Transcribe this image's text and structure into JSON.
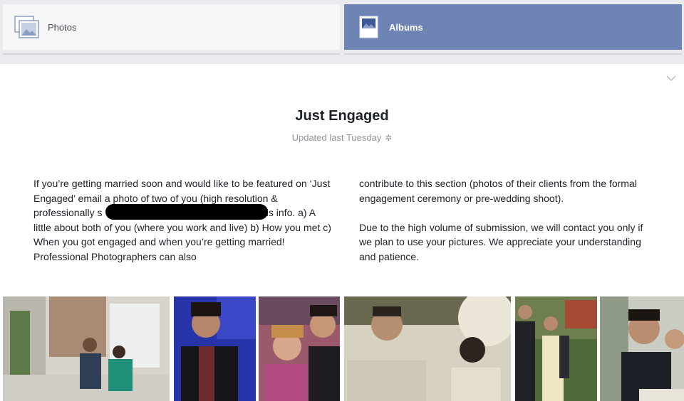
{
  "tabs": [
    {
      "label": "Photos",
      "icon": "photos-icon",
      "active": false
    },
    {
      "label": "Albums",
      "icon": "album-icon",
      "active": true
    }
  ],
  "album": {
    "title": "Just Engaged",
    "updated": "Updated last Tuesday",
    "audience_icon": "gear-icon",
    "description_left": "If you’re getting married soon and would like to be featured on ‘Just Engaged’ email a photo of two of you (high resolution & professionally s                                    Also include this info. a) A little about both of you (where you work and live) b) How you met c) When you got engaged and when you’re getting married! Professional Photographers can also",
    "description_right_1": "contribute to this section (photos of their clients from the formal engagement ceremony or pre-wedding shoot).",
    "description_right_2": "Due to the high volume of submission, we will contact you only if we plan to use your pictures. We appreciate your understanding and patience."
  },
  "colors": {
    "active_tab": "#6d84b4",
    "background": "#e9ebee"
  }
}
